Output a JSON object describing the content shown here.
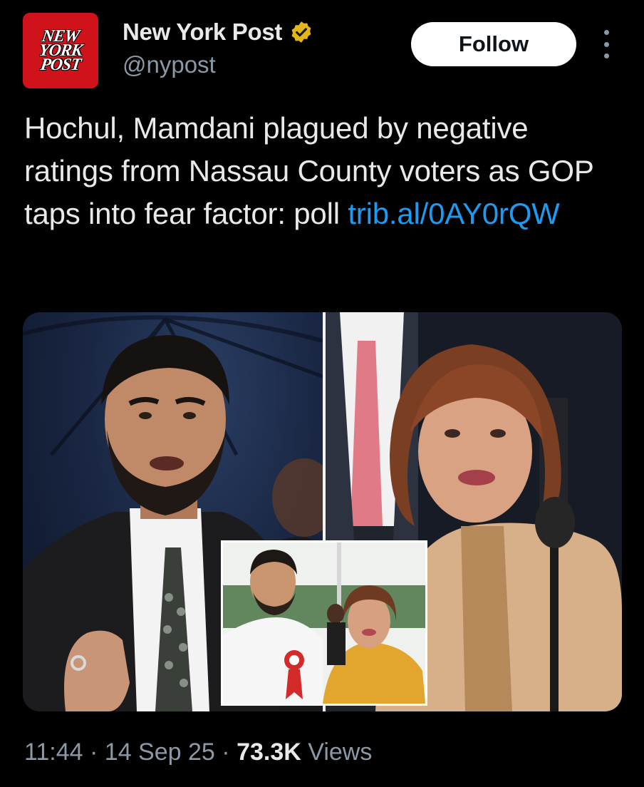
{
  "account": {
    "logo_lines": [
      "NEW",
      "YORK",
      "POST"
    ],
    "display_name": "New York Post",
    "handle": "@nypost",
    "verified_badge_color": "#e2b719",
    "follow_label": "Follow",
    "more_icon": "more-vertical-icon"
  },
  "tweet": {
    "text": "Hochul, Mamdani plagued by negative ratings from Nassau County voters as GOP taps into fear factor: poll ",
    "link": "trib.al/0AY0rQW"
  },
  "meta": {
    "time": "11:44",
    "separator": "·",
    "date": "14 Sep 25",
    "views_count": "73.3K",
    "views_label": "Views"
  },
  "colors": {
    "background": "#000000",
    "text": "#e7e9ea",
    "muted": "#8b98a5",
    "link": "#1d9bf0",
    "logo_red": "#d0121b"
  }
}
